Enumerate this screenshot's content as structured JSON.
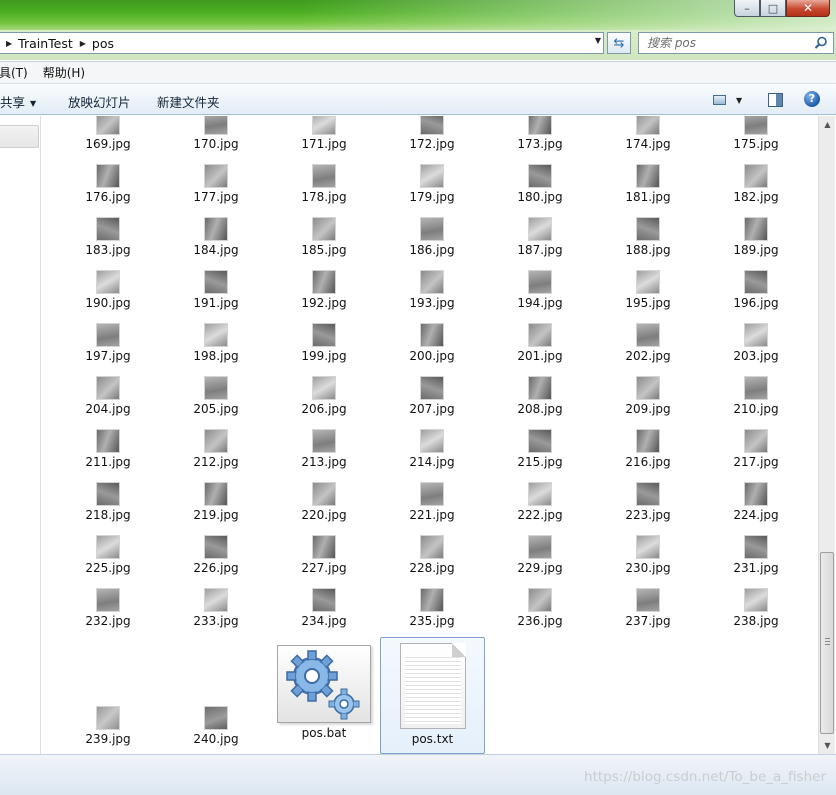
{
  "window": {
    "minimize_glyph": "–",
    "maximize_glyph": "□",
    "close_glyph": "✕"
  },
  "address": {
    "breadcrumb": [
      "TrainTest",
      "pos"
    ]
  },
  "search": {
    "placeholder": "搜索 pos"
  },
  "menu": {
    "items": [
      "具(T)",
      "帮助(H)"
    ]
  },
  "toolbar": {
    "share_label": "共享",
    "slideshow_label": "放映幻灯片",
    "new_folder_label": "新建文件夹"
  },
  "files": {
    "thumb_rows": [
      [
        "169.jpg",
        "170.jpg",
        "171.jpg",
        "172.jpg",
        "173.jpg",
        "174.jpg",
        "175.jpg"
      ],
      [
        "176.jpg",
        "177.jpg",
        "178.jpg",
        "179.jpg",
        "180.jpg",
        "181.jpg",
        "182.jpg"
      ],
      [
        "183.jpg",
        "184.jpg",
        "185.jpg",
        "186.jpg",
        "187.jpg",
        "188.jpg",
        "189.jpg"
      ],
      [
        "190.jpg",
        "191.jpg",
        "192.jpg",
        "193.jpg",
        "194.jpg",
        "195.jpg",
        "196.jpg"
      ],
      [
        "197.jpg",
        "198.jpg",
        "199.jpg",
        "200.jpg",
        "201.jpg",
        "202.jpg",
        "203.jpg"
      ],
      [
        "204.jpg",
        "205.jpg",
        "206.jpg",
        "207.jpg",
        "208.jpg",
        "209.jpg",
        "210.jpg"
      ],
      [
        "211.jpg",
        "212.jpg",
        "213.jpg",
        "214.jpg",
        "215.jpg",
        "216.jpg",
        "217.jpg"
      ],
      [
        "218.jpg",
        "219.jpg",
        "220.jpg",
        "221.jpg",
        "222.jpg",
        "223.jpg",
        "224.jpg"
      ],
      [
        "225.jpg",
        "226.jpg",
        "227.jpg",
        "228.jpg",
        "229.jpg",
        "230.jpg",
        "231.jpg"
      ],
      [
        "232.jpg",
        "233.jpg",
        "234.jpg",
        "235.jpg",
        "236.jpg",
        "237.jpg",
        "238.jpg"
      ]
    ],
    "last_row": [
      "239.jpg",
      "240.jpg"
    ],
    "bat_file": "pos.bat",
    "txt_file": "pos.txt"
  },
  "watermark": "https://blog.csdn.net/To_be_a_fisher",
  "colors": {
    "aero_green": "#4cae23",
    "selection_border": "#7da2ce",
    "toolbar_text": "#14253a"
  }
}
